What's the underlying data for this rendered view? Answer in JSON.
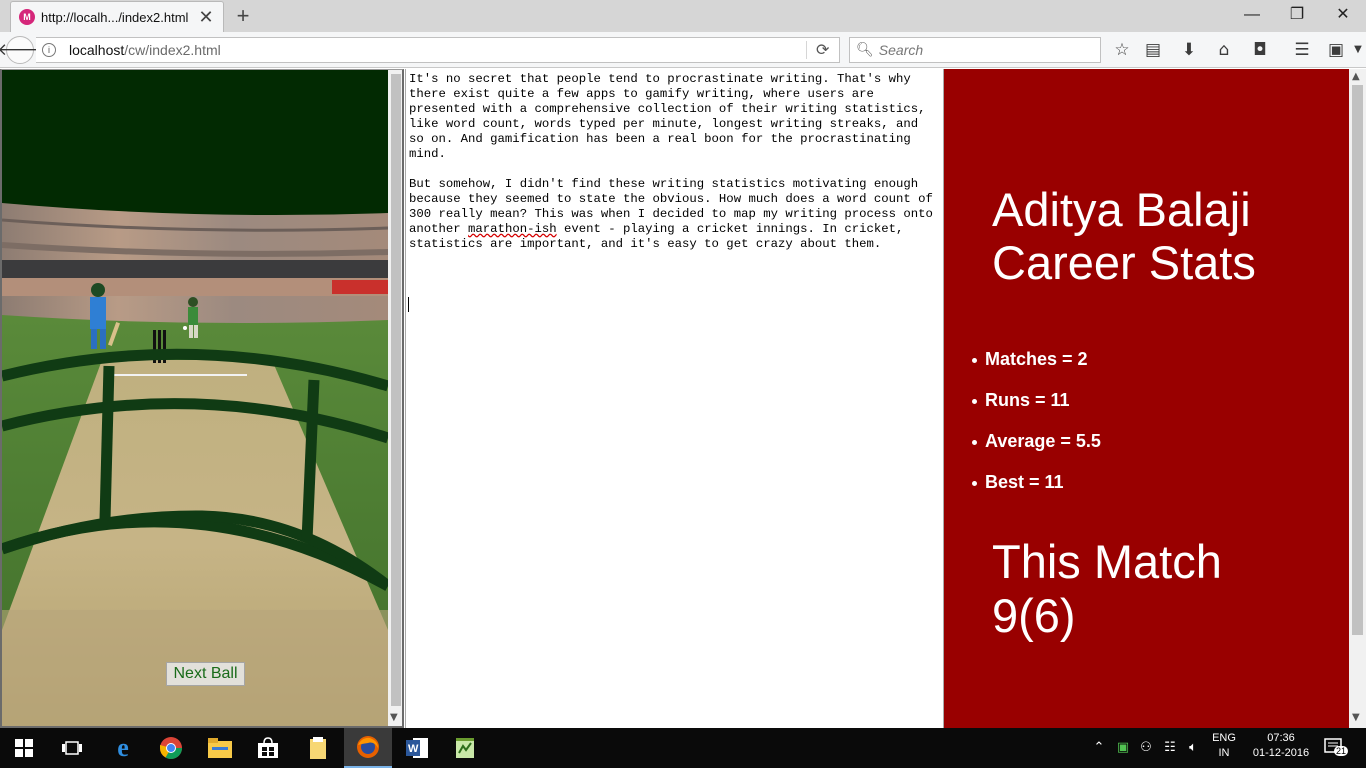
{
  "browser": {
    "tab_title": "http://localh.../index2.html",
    "tab_favicon": "M",
    "tab_close": "✕",
    "new_tab": "+",
    "window_controls": [
      "—",
      "❐",
      "✕"
    ],
    "url_host": "localhost",
    "url_path": "/cw/index2.html",
    "search_placeholder": "Search",
    "icons": [
      "back-icon",
      "info-icon",
      "reload-icon",
      "search-icon",
      "bookmark-star-icon",
      "reader-list-icon",
      "download-icon",
      "home-icon",
      "pocket-icon",
      "menu-icon",
      "addon-icon"
    ]
  },
  "game": {
    "next_ball_label": "Next Ball"
  },
  "editor": {
    "paragraphs": [
      "It's no secret that people tend to procrastinate writing. That's why there exist quite a few apps to gamify writing, where users are presented with a comprehensive collection of their writing statistics, like word count, words typed per minute, longest writing streaks, and so on. And gamification has been a real boon for the procrastinating mind.",
      "But somehow, I didn't find these writing statistics motivating enough because they seemed to state the obvious. How much does a word count of 300 really mean? This was when I decided to map my writing process onto another marathon-ish event - playing a cricket innings. In cricket, statistics are important, and it's easy to get crazy about them."
    ],
    "p2_before": "But somehow, I didn't find these writing statistics motivating enough because they seemed to state the obvious. How much does a word count of 300 really mean? This was when I decided to map my writing process onto another ",
    "p2_misspelled": "marathon-ish",
    "p2_after": " event - playing a cricket innings. In cricket, statistics are important, and it's easy to get crazy about them."
  },
  "stats": {
    "career_title": "Aditya Balaji Career Stats",
    "items": [
      {
        "label": "Matches = 2"
      },
      {
        "label": "Runs = 11"
      },
      {
        "label": "Average = 5.5"
      },
      {
        "label": "Best = 11"
      }
    ],
    "match_title": "This Match",
    "match_score": "9(6)",
    "background_color": "#990000"
  },
  "taskbar": {
    "language_top": "ENG",
    "language_bottom": "IN",
    "time": "07:36",
    "date": "01-12-2016",
    "notification_count": "21",
    "apps": [
      "windows-start-icon",
      "task-view-icon",
      "edge-icon",
      "chrome-icon",
      "file-explorer-icon",
      "store-icon",
      "folder-icon",
      "firefox-icon",
      "word-icon",
      "notepad-icon"
    ]
  }
}
